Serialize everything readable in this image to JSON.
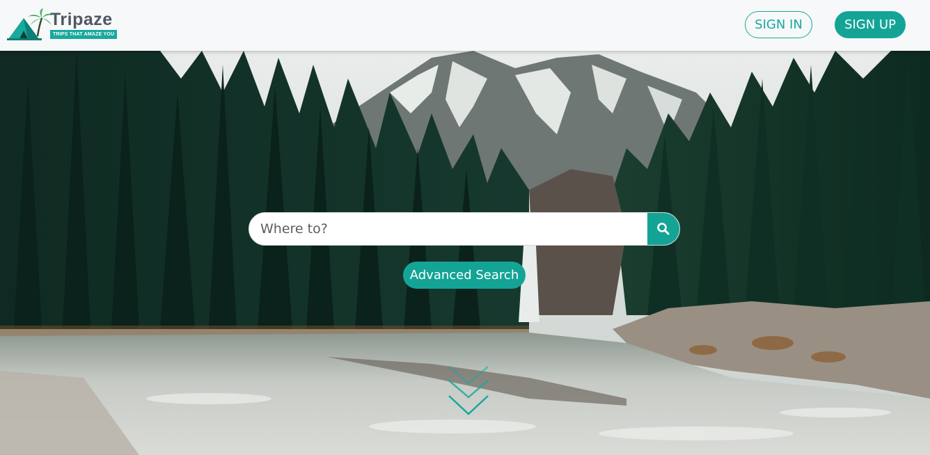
{
  "header": {
    "logo": {
      "wordmark": "Tripaze",
      "tagline": "TRIPS THAT AMAZE YOU"
    },
    "sign_in_label": "SIGN IN",
    "sign_up_label": "SIGN UP"
  },
  "hero": {
    "search": {
      "placeholder": "Where to?",
      "value": "",
      "icon": "search-icon"
    },
    "advanced_search_label": "Advanced Search",
    "scroll_icon": "double-chevron-down-icon"
  },
  "colors": {
    "accent": "#14a496",
    "header_bg": "#f7f8fa",
    "logo_text": "#505862"
  }
}
